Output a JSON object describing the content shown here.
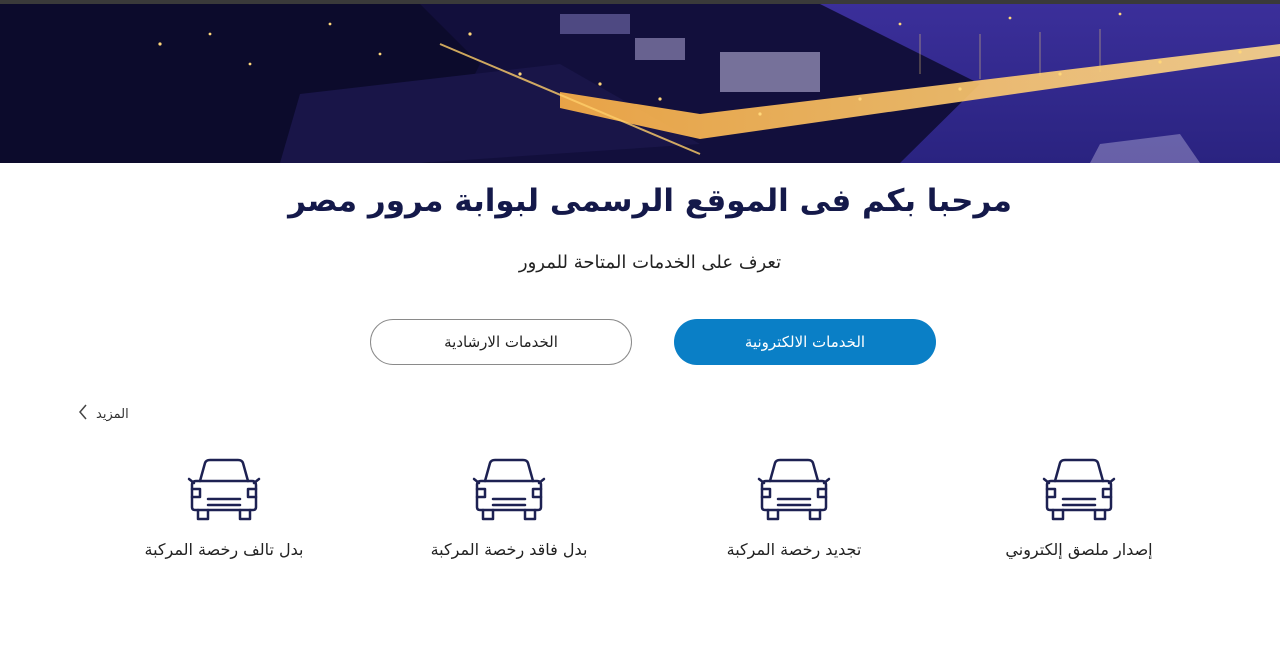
{
  "hero": {
    "image": "nile-city-night-bridge"
  },
  "welcome": {
    "title": "مرحبا بكم فى الموقع الرسمى لبوابة مرور مصر",
    "subtitle": "تعرف على الخدمات المتاحة للمرور"
  },
  "tabs": [
    {
      "label": "الخدمات الالكترونية",
      "active": true
    },
    {
      "label": "الخدمات الارشادية",
      "active": false
    }
  ],
  "more": {
    "label": "المزيد",
    "icon": "chevron-left-icon"
  },
  "services": [
    {
      "label": "إصدار ملصق إلكتروني",
      "icon": "car-icon"
    },
    {
      "label": "تجديد رخصة المركبة",
      "icon": "car-icon"
    },
    {
      "label": "بدل فاقد رخصة المركبة",
      "icon": "car-icon"
    },
    {
      "label": "بدل تالف رخصة المركبة",
      "icon": "car-icon"
    }
  ],
  "colors": {
    "accent": "#0a7fc6",
    "title": "#14194a",
    "icon": "#1d2152"
  }
}
